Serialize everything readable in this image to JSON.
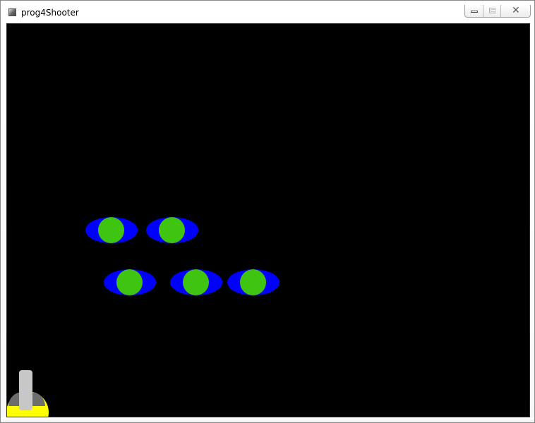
{
  "window": {
    "title": "prog4Shooter",
    "controls": {
      "minimize_icon": "minimize-icon",
      "maximize_icon": "maximize-icon",
      "close_icon": "close-icon",
      "close_glyph": "✕"
    }
  },
  "game": {
    "background_color": "#000000",
    "enemy_colors": {
      "body": "#0000ff",
      "core": "#3fc40f"
    },
    "player_colors": {
      "dome": "#ffff00",
      "barrel": "#c7c7c7",
      "shadow": "#6e6e6e"
    },
    "enemy_count": 5
  }
}
